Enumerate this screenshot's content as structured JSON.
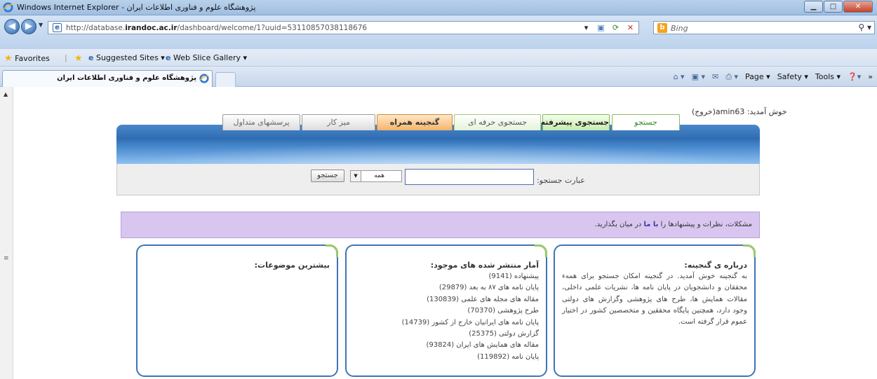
{
  "browser": {
    "window_title": "Windows Internet Explorer - پژوهشگاه علوم و فناوری اطلاعات ایران",
    "url_prefix": "http://database.",
    "url_domain": "irandoc.ac.ir",
    "url_suffix": "/dashboard/welcome/1?uuid=53110857038118676",
    "search_provider": "Bing",
    "favorites": {
      "favorites_label": "Favorites",
      "suggested_sites": "Suggested Sites ▾",
      "web_slice_gallery": "Web Slice Gallery ▾"
    },
    "tab_title": "پژوهشگاه علوم و فناوری اطلاعات ایران",
    "commands": {
      "page": "Page ▾",
      "safety": "Safety ▾",
      "tools": "Tools ▾"
    }
  },
  "site": {
    "welcome": "خوش آمدید: amin63(خروج)",
    "nav_tabs": [
      {
        "label": "جستجو"
      },
      {
        "label": "جستجوی پیشرفته"
      },
      {
        "label": "جستجوی حرفه ای"
      },
      {
        "label": "گنجینه همراه"
      },
      {
        "label": "میز کار"
      },
      {
        "label": "پرسشهای متداول"
      }
    ],
    "search": {
      "label": "عبارت جستجو:",
      "query_value": "",
      "scope_value": "همه",
      "button_label": "جستجو"
    },
    "notice": {
      "before": "مشکلات، نظرات و پیشنهادها را ",
      "link": "با ما",
      "after": " در میان بگذارید."
    },
    "about": {
      "heading": "درباره ی گنجینه:",
      "text": "به گنجینه خوش آمدید. در گنجینه امکان جستجو برای همهء محققان و دانشجویان در پایان نامه ها، نشریات علمی داخلی، مقالات همایش ها، طرح های پژوهشی وگزارش های دولتی وجود دارد، همچنین پایگاه محققین و متخصصین کشور در اختیار عموم قرار گرفته است."
    },
    "stats": {
      "heading": "آمار منتشر شده های موجود:",
      "items": [
        "پیشنهاده (9141)",
        "پایان نامه های ۸۷ به بعد (29879)",
        "مقاله های مجله های علمی (130839)",
        "طرح پژوهشی (70370)",
        "پایان نامه های ایرانیان خارج از کشور (14739)",
        "گزارش دولتی (25375)",
        "مقاله های همایش های ایران (93824)",
        "پایان نامه (119892)"
      ]
    },
    "topics": {
      "heading": "بیشترین موضوعات:"
    }
  }
}
